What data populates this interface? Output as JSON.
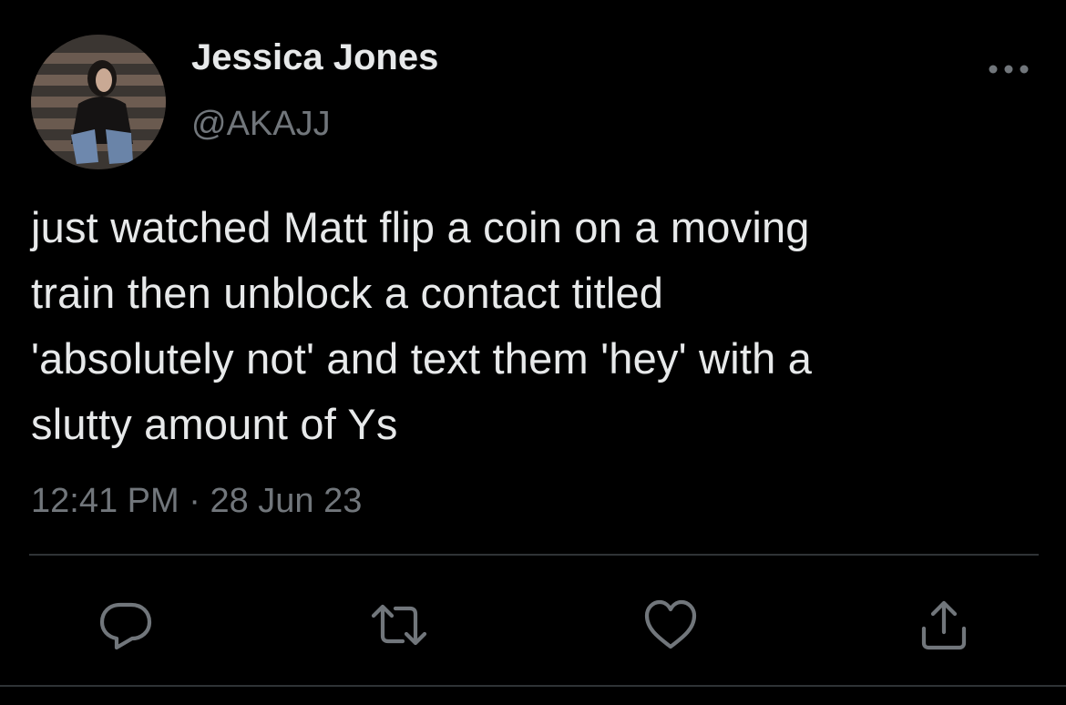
{
  "tweet": {
    "display_name": "Jessica Jones",
    "handle": "@AKAJJ",
    "text_lines": [
      "just watched Matt flip a coin on a moving",
      "train then unblock a contact titled",
      "'absolutely not' and text them 'hey' with a",
      "slutty amount of Ys"
    ],
    "time": "12:41 PM",
    "separator": "·",
    "date": "28 Jun 23"
  },
  "icons": {
    "more": "more-horizontal-icon",
    "reply": "reply-icon",
    "retweet": "retweet-icon",
    "like": "heart-icon",
    "share": "share-icon"
  },
  "colors": {
    "background": "#000000",
    "primary_text": "#e7e9ea",
    "secondary_text": "#71767b",
    "divider": "#2f3336"
  }
}
